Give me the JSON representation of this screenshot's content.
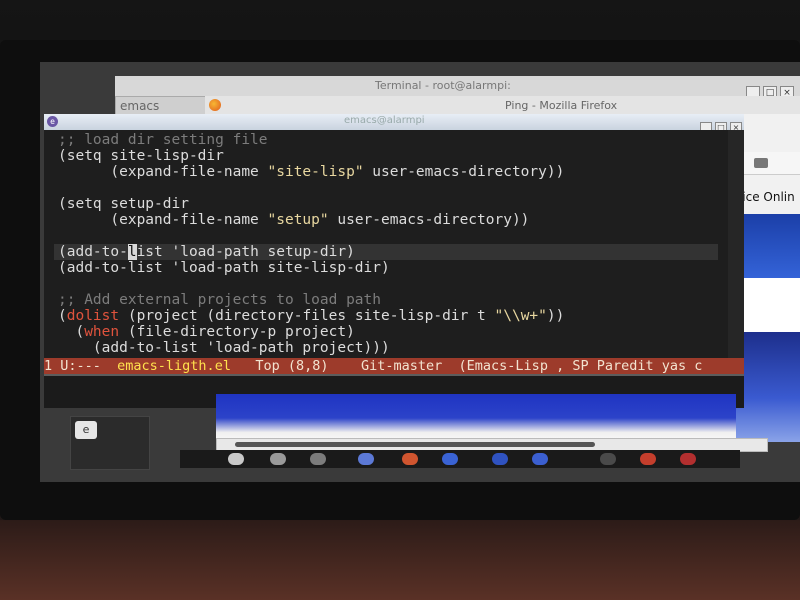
{
  "windows": {
    "terminal_title": "Terminal - root@alarmpi:",
    "emacs_tab_label": "emacs",
    "firefox_title": "Ping - Mozilla Firefox",
    "emacs_title": "emacs@alarmpi"
  },
  "firefox": {
    "visible_text": "ffice Onlin"
  },
  "editor": {
    "lines": {
      "l1": ";; load dir setting file",
      "l2": "(setq site-lisp-dir",
      "l3_a": "      (expand-file-name ",
      "l3_s": "\"site-lisp\"",
      "l3_b": " user-emacs-directory))",
      "l5": "(setq setup-dir",
      "l6_a": "      (expand-file-name ",
      "l6_s": "\"setup\"",
      "l6_b": " user-emacs-directory))",
      "l8_a": "(add-to-",
      "l8_cursor": "l",
      "l8_b": "ist 'load-path setup-dir)",
      "l9": "(add-to-list 'load-path site-lisp-dir)",
      "l11": ";; Add external projects to load path",
      "l12_open": "(",
      "l12_kw": "dolist",
      "l12_a": " (project (directory-files site-lisp-dir t ",
      "l12_s": "\"\\\\w+\"",
      "l12_b": "))",
      "l13_open": "  (",
      "l13_kw": "when",
      "l13_b": " (file-directory-p project)",
      "l14": "    (add-to-list 'load-path project)))"
    }
  },
  "modeline": {
    "status": "1 U:---  ",
    "buffer_name": "emacs-ligth.el",
    "position": "   Top (8,8)    ",
    "vc": "Git-master",
    "modes": "  (Emacs-Lisp , SP Paredit yas c"
  },
  "desktop": {
    "panel_app_icon": "emacs-icon"
  },
  "colors": {
    "modeline_bg": "#9d3b2b",
    "buffer_name": "#ffe14d",
    "keyword": "#e0533d",
    "string": "#e8d7a0",
    "comment": "#7c7c7c",
    "editor_bg": "#1e1e1e"
  }
}
